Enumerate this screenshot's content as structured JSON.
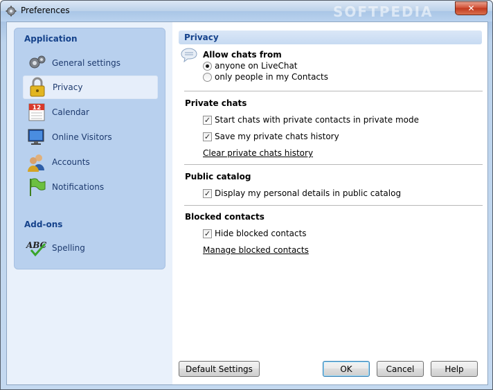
{
  "window": {
    "title": "Preferences",
    "watermark": "SOFTPEDIA"
  },
  "sidebar": {
    "application_heading": "Application",
    "items": [
      {
        "label": "General settings",
        "icon": "gear-icon"
      },
      {
        "label": "Privacy",
        "icon": "lock-icon",
        "selected": true
      },
      {
        "label": "Calendar",
        "icon": "calendar-icon",
        "day": "12"
      },
      {
        "label": "Online Visitors",
        "icon": "monitor-icon"
      },
      {
        "label": "Accounts",
        "icon": "users-icon"
      },
      {
        "label": "Notifications",
        "icon": "flag-icon"
      }
    ],
    "addons_heading": "Add-ons",
    "addons": [
      {
        "label": "Spelling",
        "icon": "spellcheck-icon",
        "icon_text": "ABC"
      }
    ]
  },
  "privacy": {
    "header": "Privacy",
    "allow_chats": {
      "title": "Allow chats from",
      "options": [
        {
          "label": "anyone on LiveChat",
          "selected": true
        },
        {
          "label": "only people in my Contacts",
          "selected": false
        }
      ]
    },
    "private_chats": {
      "title": "Private chats",
      "options": [
        {
          "label": "Start chats with private contacts in private mode",
          "checked": true
        },
        {
          "label": "Save my private chats history",
          "checked": true
        }
      ],
      "link": "Clear private chats history"
    },
    "public_catalog": {
      "title": "Public catalog",
      "options": [
        {
          "label": "Display my personal details in public catalog",
          "checked": true
        }
      ]
    },
    "blocked_contacts": {
      "title": "Blocked contacts",
      "options": [
        {
          "label": "Hide blocked contacts",
          "checked": true
        }
      ],
      "link": "Manage blocked contacts"
    }
  },
  "buttons": {
    "default_settings": "Default Settings",
    "ok": "OK",
    "cancel": "Cancel",
    "help": "Help"
  },
  "glyphs": {
    "check": "✓",
    "close": "✕"
  }
}
